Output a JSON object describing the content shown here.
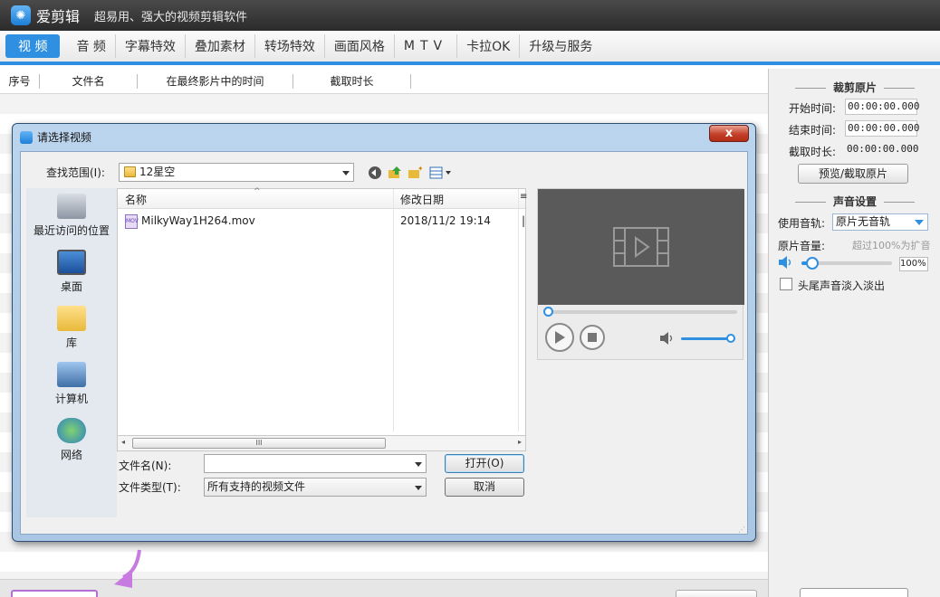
{
  "app": {
    "name": "爱剪辑",
    "slogan": "超易用、强大的视频剪辑软件"
  },
  "tabs": [
    {
      "label": "视 频",
      "active": true
    },
    {
      "label": "音 频"
    },
    {
      "label": "字幕特效"
    },
    {
      "label": "叠加素材"
    },
    {
      "label": "转场特效"
    },
    {
      "label": "画面风格"
    },
    {
      "label": "MTV"
    },
    {
      "label": "卡拉OK"
    },
    {
      "label": "升级与服务"
    }
  ],
  "list": {
    "columns": [
      "序号",
      "文件名",
      "在最终影片中的时间",
      "截取时长"
    ]
  },
  "right_panel": {
    "crop_title": "裁剪原片",
    "start_label": "开始时间:",
    "start_value": "00:00:00.000",
    "end_label": "结束时间:",
    "end_value": "00:00:00.000",
    "duration_label": "截取时长:",
    "duration_value": "00:00:00.000",
    "preview_button": "预览/截取原片",
    "sound_title": "声音设置",
    "track_label": "使用音轨:",
    "track_value": "原片无音轨",
    "volume_label": "原片音量:",
    "volume_note": "超过100%为扩音",
    "volume_value": "100%",
    "volume_level_fraction": 0.12,
    "fade_label": "头尾声音淡入淡出"
  },
  "dialog": {
    "title": "请选择视频",
    "close_symbol": "x",
    "lookin_label": "查找范围(I):",
    "lookin_value": "12星空",
    "places": [
      "最近访问的位置",
      "桌面",
      "库",
      "计算机",
      "网络"
    ],
    "columns": [
      "名称",
      "修改日期"
    ],
    "files": [
      {
        "name": "MilkyWay1H264.mov",
        "modified": "2018/11/2 19:14",
        "icon_text": "MOV"
      }
    ],
    "scroll_thumb": "III",
    "filename_label": "文件名(N):",
    "filename_value": "",
    "filetype_label": "文件类型(T):",
    "filetype_value": "所有支持的视频文件",
    "open_button": "打开(O)",
    "cancel_button": "取消"
  },
  "colors": {
    "accent": "#2f8fe0",
    "titlebar": "#333333",
    "dialog_frame": "#b3cde9",
    "close_button": "#c4402a",
    "hint_arrow": "#c77be0"
  },
  "icons": {
    "app": "app-logo-icon",
    "back": "back-arrow-icon",
    "up": "up-folder-icon",
    "new_folder": "new-folder-icon",
    "view": "view-menu-icon",
    "video_placeholder": "film-play-icon",
    "play": "play-icon",
    "stop": "stop-icon",
    "speaker": "speaker-icon"
  }
}
